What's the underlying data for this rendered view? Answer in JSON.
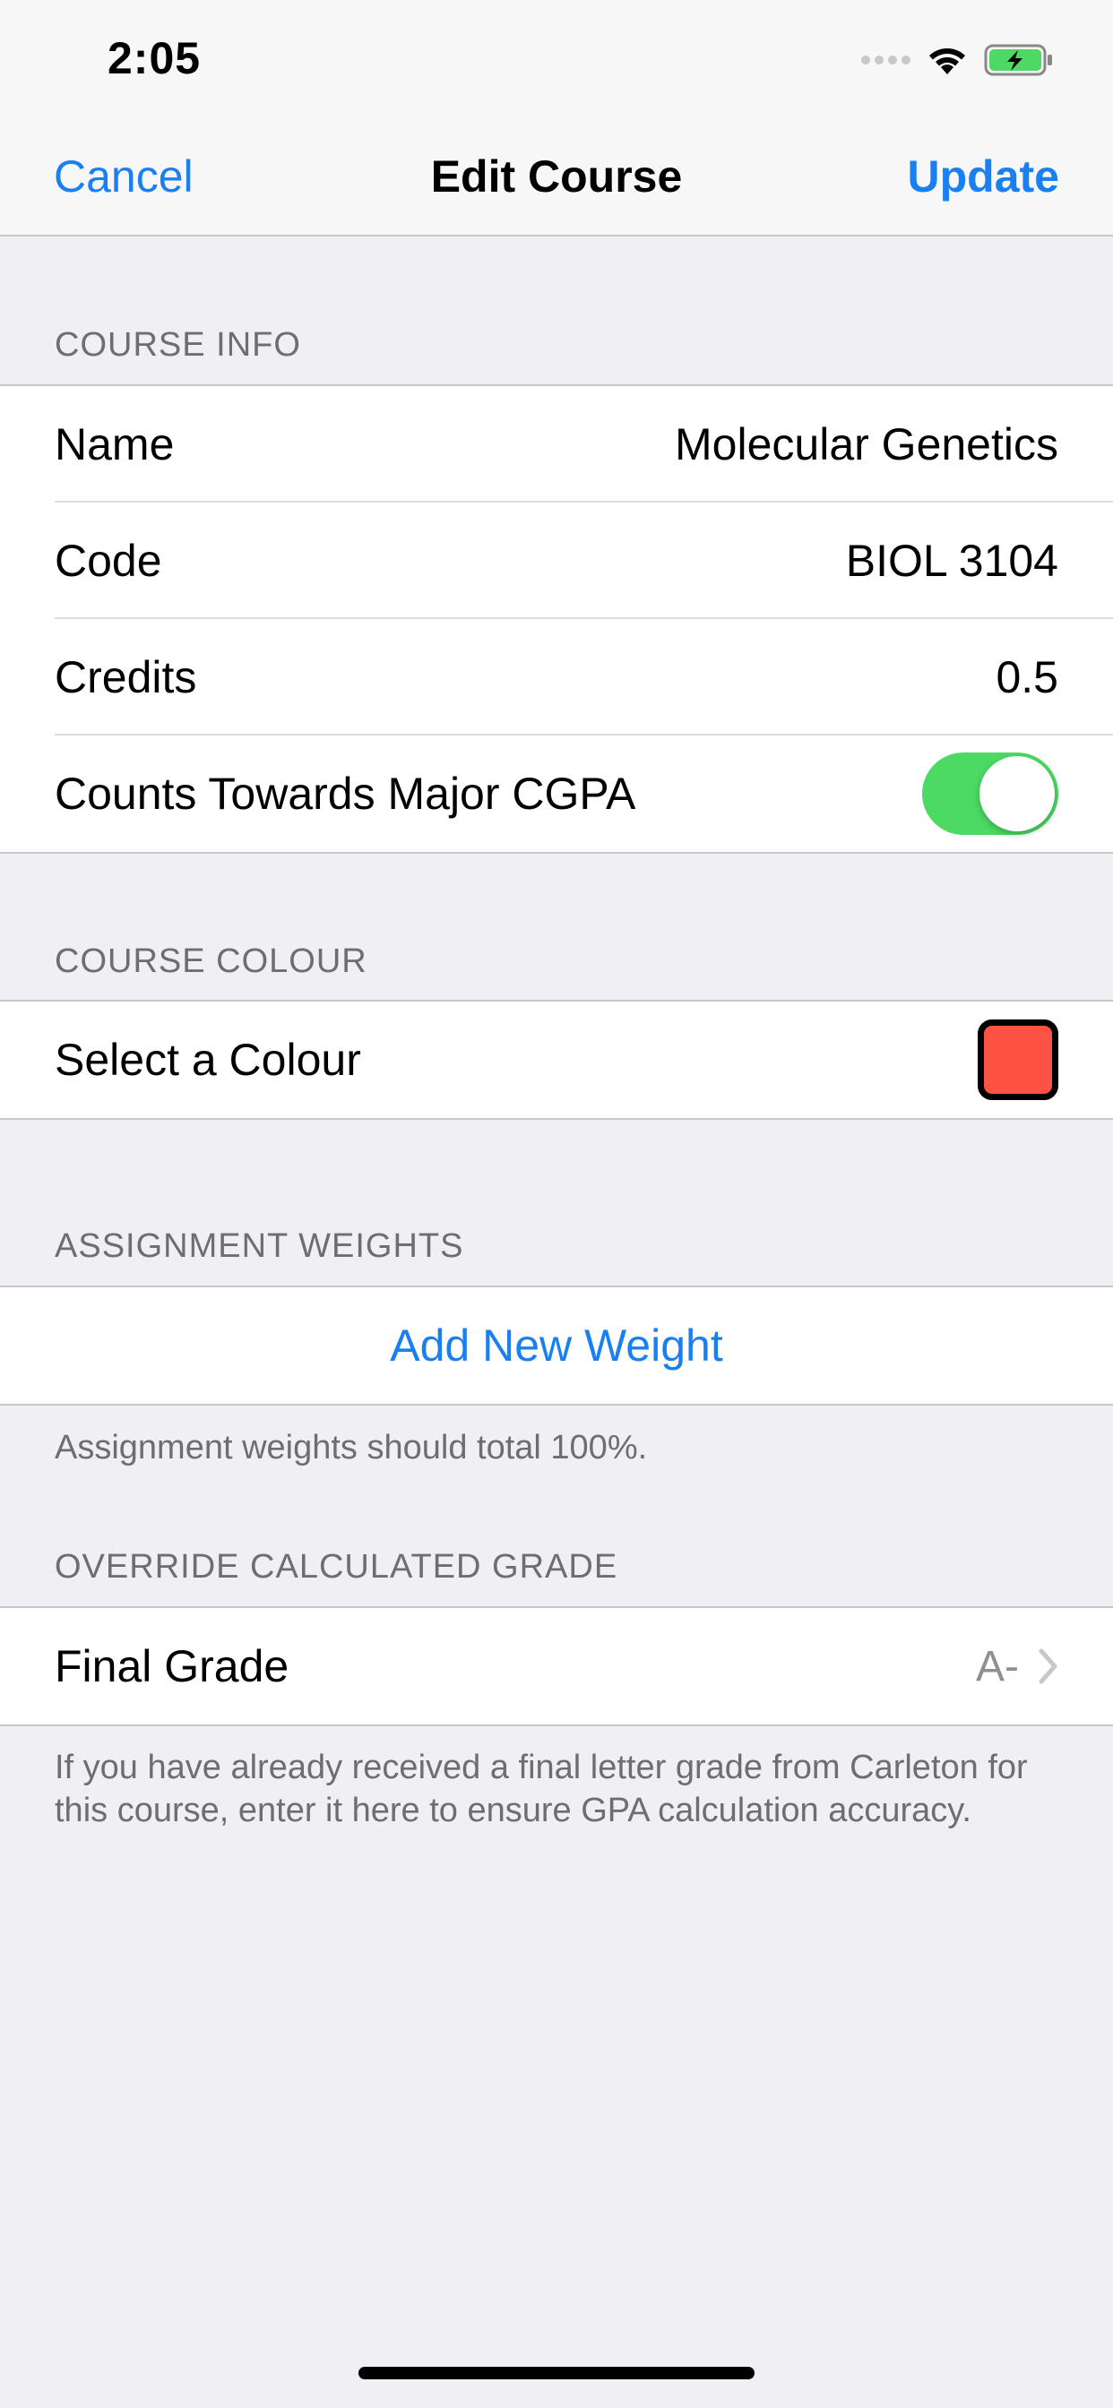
{
  "status_bar": {
    "time": "2:05"
  },
  "nav": {
    "cancel_label": "Cancel",
    "title": "Edit Course",
    "update_label": "Update"
  },
  "sections": {
    "course_info": {
      "header": "COURSE INFO",
      "rows": [
        {
          "label": "Name",
          "value": "Molecular Genetics"
        },
        {
          "label": "Code",
          "value": "BIOL 3104"
        },
        {
          "label": "Credits",
          "value": "0.5"
        },
        {
          "label": "Counts Towards Major CGPA",
          "toggle_on": true
        }
      ]
    },
    "course_colour": {
      "header": "COURSE COLOUR",
      "row_label": "Select a Colour",
      "selected_colour": "#fe5244"
    },
    "assignment_weights": {
      "header": "ASSIGNMENT WEIGHTS",
      "add_label": "Add New Weight",
      "footer": "Assignment weights should total 100%."
    },
    "override_grade": {
      "header": "OVERRIDE CALCULATED GRADE",
      "row_label": "Final Grade",
      "row_value": "A-",
      "footer": "If you have already received a final letter grade from Carleton for this course, enter it here to ensure GPA calculation accuracy."
    }
  },
  "colors": {
    "accent": "#1a7ff0",
    "toggle_on": "#4cd964",
    "background": "#efeff4"
  },
  "icons": {
    "wifi": "wifi-icon",
    "battery": "battery-charging-icon",
    "signal": "signal-icon",
    "disclosure": "chevron-right-icon"
  }
}
